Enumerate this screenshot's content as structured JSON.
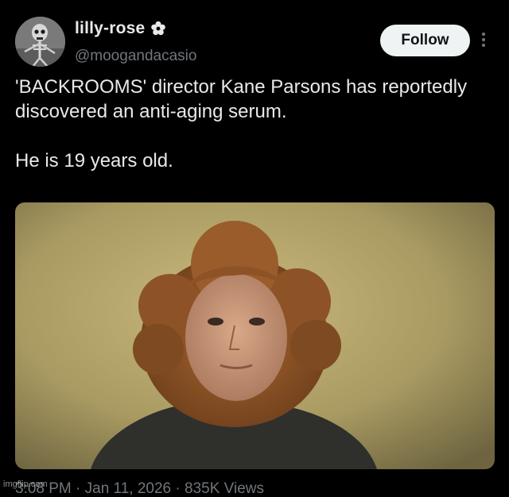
{
  "author": {
    "display_name": "lilly-rose",
    "handle": "@moogandacasio",
    "badge_icon": "flower-badge-icon"
  },
  "actions": {
    "follow_label": "Follow",
    "more_icon": "more-vertical-icon"
  },
  "tweet": {
    "line1": "'BACKROOMS' director Kane Parsons has reportedly discovered an anti-aging serum.",
    "line2": "He is 19 years old."
  },
  "footer": {
    "meta_text": "3:08 PM · Jan 11, 2026 · 835K Views"
  },
  "watermark": "imgflip.com",
  "colors": {
    "background": "#000000",
    "text_primary": "#e7e9ea",
    "text_secondary": "#71767b",
    "follow_bg": "#eff3f4"
  }
}
